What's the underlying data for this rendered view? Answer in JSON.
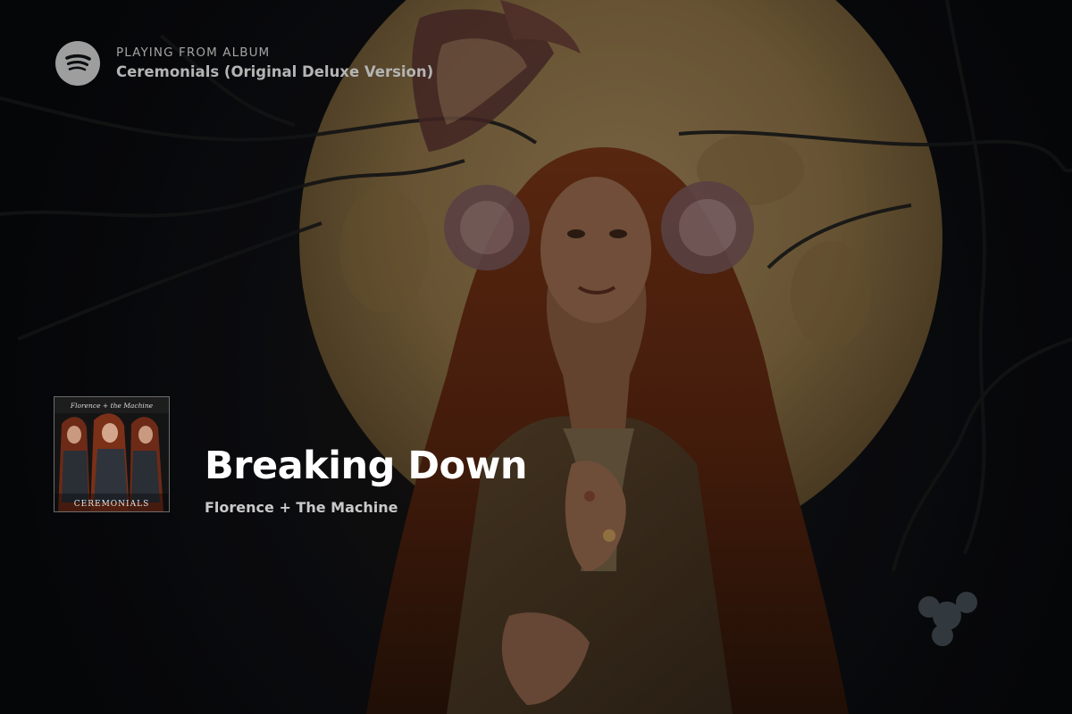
{
  "colors": {
    "background": "#0c0e12",
    "moon": "#a98b56",
    "hair": "#6a2e16",
    "title_text": "#ffffff",
    "subtitle_text": "#c9c9c9",
    "logo_gray": "#9e9e9e"
  },
  "header": {
    "logo_icon": "spotify-logo-icon",
    "context_label": "PLAYING FROM ALBUM",
    "album_name": "Ceremonials (Original Deluxe Version)"
  },
  "now_playing": {
    "cover_art": {
      "band_text": "Florence + the Machine",
      "album_text": "CEREMONIALS"
    },
    "track_title": "Breaking Down",
    "artist_name": "Florence + The Machine"
  }
}
